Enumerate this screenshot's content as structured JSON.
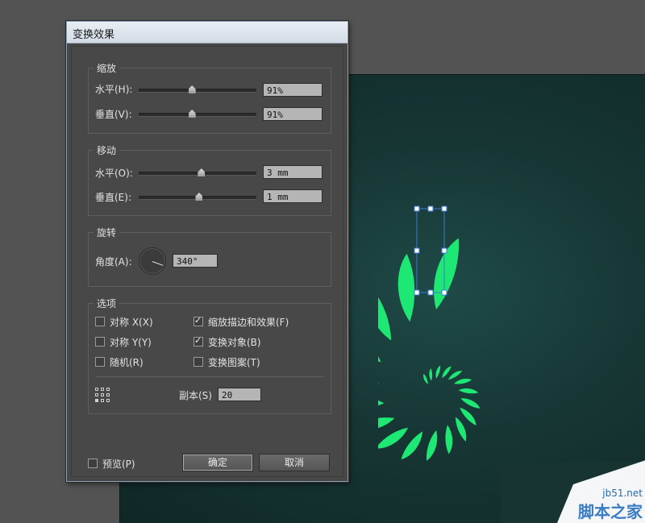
{
  "dialog": {
    "title": "变换效果",
    "scale": {
      "title": "缩放",
      "horizontal_label": "水平(H):",
      "horizontal_value": "91%",
      "horizontal_slider_fraction": 0.45,
      "vertical_label": "垂直(V):",
      "vertical_value": "91%",
      "vertical_slider_fraction": 0.45
    },
    "move": {
      "title": "移动",
      "horizontal_label": "水平(O):",
      "horizontal_value": "3 mm",
      "horizontal_slider_fraction": 0.53,
      "vertical_label": "垂直(E):",
      "vertical_value": "1 mm",
      "vertical_slider_fraction": 0.51
    },
    "rotate": {
      "title": "旋转",
      "angle_label": "角度(A):",
      "angle_value": "340°"
    },
    "options": {
      "title": "选项",
      "reflect_x": {
        "label": "对称 X(X)",
        "checked": false
      },
      "reflect_y": {
        "label": "对称 Y(Y)",
        "checked": false
      },
      "random": {
        "label": "随机(R)",
        "checked": false
      },
      "scale_strokes": {
        "label": "缩放描边和效果(F)",
        "checked": true
      },
      "transform_objects": {
        "label": "变换对象(B)",
        "checked": true
      },
      "transform_patterns": {
        "label": "变换图案(T)",
        "checked": false
      },
      "copies_label": "副本(S)",
      "copies_value": "20"
    },
    "preview": {
      "label": "预览(P)",
      "checked": false
    },
    "ok_label": "确定",
    "cancel_label": "取消"
  },
  "canvas": {
    "artboard_color": "#163634",
    "shape_color": "#1ee874",
    "selection_color": "#3a7bd5"
  },
  "watermark": {
    "site": "jb51.net",
    "name": "脚本之家"
  }
}
